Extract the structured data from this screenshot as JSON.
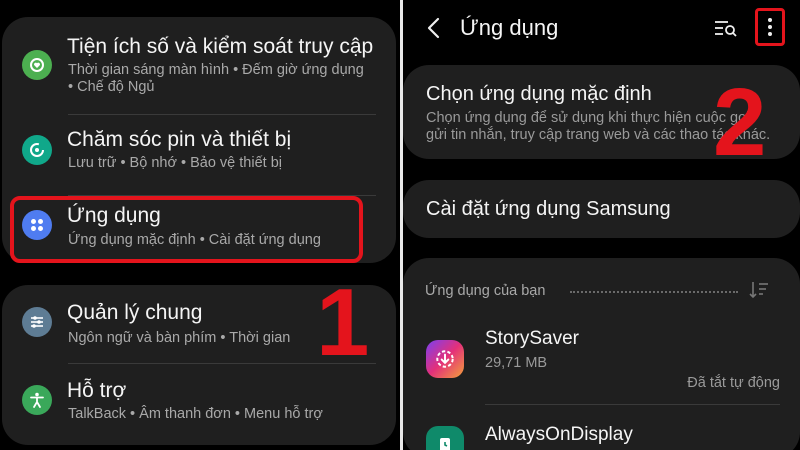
{
  "left": {
    "items": [
      {
        "title": "Tiện ích số và kiểm soát truy cập",
        "sub1": "Thời gian sáng màn hình  •  Đếm giờ ứng dụng",
        "sub2": "•  Chế độ Ngủ",
        "icon": "digital-wellbeing-icon",
        "color": "#4caf50"
      },
      {
        "title": "Chăm sóc pin và thiết bị",
        "sub1": "Lưu trữ  •  Bộ nhớ  •  Bảo vệ thiết bị",
        "icon": "device-care-icon",
        "color": "#10a88a"
      },
      {
        "title": "Ứng dụng",
        "sub1": "Ứng dụng mặc định  •  Cài đặt ứng dụng",
        "icon": "apps-icon",
        "color": "#4f7cf0"
      },
      {
        "title": "Quản lý chung",
        "sub1": "Ngôn ngữ và bàn phím  •  Thời gian",
        "icon": "general-management-icon",
        "color": "#5e7c94"
      },
      {
        "title": "Hỗ trợ",
        "sub1": "TalkBack  •  Âm thanh đơn  •  Menu hỗ trợ",
        "icon": "accessibility-icon",
        "color": "#3aa85a"
      }
    ],
    "step_number": "1"
  },
  "right": {
    "header": {
      "title": "Ứng dụng"
    },
    "default_apps": {
      "title": "Chọn ứng dụng mặc định",
      "sub1": "Chọn ứng dụng để sử dụng khi thực hiện cuộc gọi,",
      "sub2": "gửi tin nhắn, truy cập trang web và các thao tác khác."
    },
    "samsung_settings": {
      "title": "Cài đặt ứng dụng Samsung"
    },
    "your_apps_label": "Ứng dụng của bạn",
    "apps": [
      {
        "name": "StorySaver",
        "size": "29,71 MB",
        "status": "Đã tắt tự động",
        "icon": "storysaver-icon"
      },
      {
        "name": "AlwaysOnDisplay",
        "icon": "always-on-display-icon"
      }
    ],
    "step_number": "2"
  },
  "colors": {
    "highlight": "#e4141c",
    "card": "#1f1f1f",
    "background": "#000000"
  }
}
